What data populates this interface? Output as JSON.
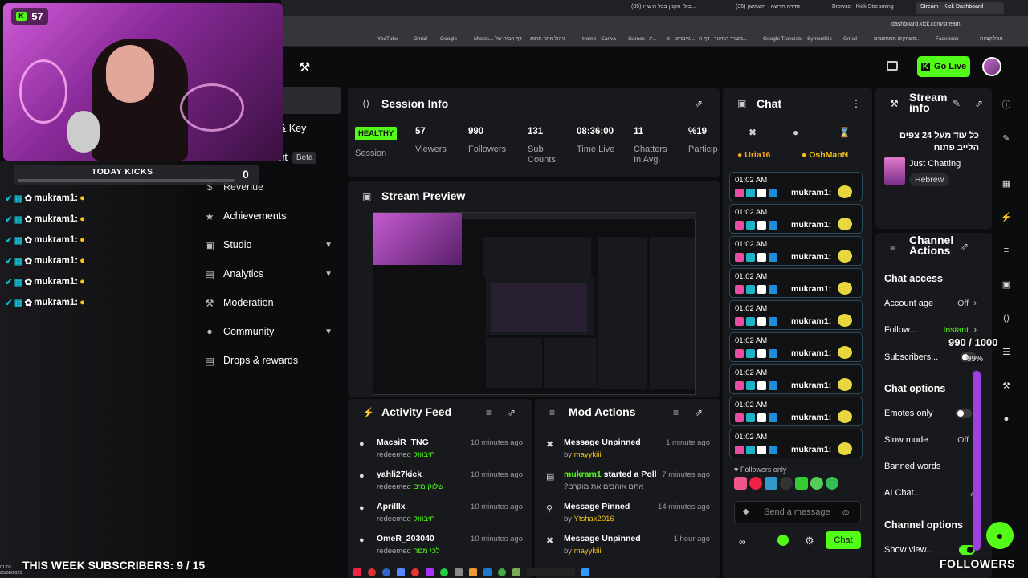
{
  "browser": {
    "tabs": [
      {
        "label": "(35) בולי הקנון בכל איש יו..."
      },
      {
        "label": "(35) סדרה חדשה - השמשון"
      },
      {
        "label": "Browse - Kick Streaming"
      },
      {
        "label": "Stream - Kick Dashboard"
      }
    ],
    "url": "dashboard.kick.com/stream",
    "bookmarks": [
      "YouTube",
      "Gmail",
      "Google",
      "Micros... דף הבית של",
      "ניהול אתר מתוא",
      "Home - Canva",
      "Games | ג'...",
      "גיימרים - פ...",
      "משרד החינוך - דף ה...",
      "Google Translate",
      "SymbolSix",
      "Gmail",
      "משחקים מתחשבים...",
      "Facebook",
      "אפליקציות"
    ]
  },
  "header": {
    "go_live": "Go Live"
  },
  "sidebar": {
    "items": [
      {
        "label": "& Key"
      },
      {
        "label": "Advertisement",
        "badge": "Beta"
      },
      {
        "label": "Revenue"
      },
      {
        "label": "Achievements"
      },
      {
        "label": "Studio"
      },
      {
        "label": "Analytics"
      },
      {
        "label": "Moderation"
      },
      {
        "label": "Community"
      },
      {
        "label": "Drops & rewards"
      }
    ]
  },
  "session": {
    "title": "Session Info",
    "status": "HEALTHY",
    "status_label": "Session",
    "stats": [
      {
        "value": "57",
        "label": "Viewers"
      },
      {
        "value": "990",
        "label": "Followers"
      },
      {
        "value": "131",
        "label": "Sub Counts"
      },
      {
        "value": "08:36:00",
        "label": "Time Live"
      },
      {
        "value": "11",
        "label": "Chatters In Avg."
      },
      {
        "value": "%19",
        "label": "Particip"
      }
    ]
  },
  "preview": {
    "title": "Stream Preview"
  },
  "activity": {
    "title": "Activity Feed",
    "items": [
      {
        "name": "MacsiR_TNG",
        "action": "redeemed",
        "reward": "חיבוווק",
        "time": "10 minutes ago"
      },
      {
        "name": "yahli27kick",
        "action": "redeemed",
        "reward": "שלוק מים",
        "time": "10 minutes ago"
      },
      {
        "name": "Aprilllx",
        "action": "redeemed",
        "reward": "חיבוווק",
        "time": "10 minutes ago"
      },
      {
        "name": "OmeR_203040",
        "action": "redeemed",
        "reward": "לכי מפה",
        "time": "10 minutes ago"
      }
    ]
  },
  "mod": {
    "title": "Mod Actions",
    "items": [
      {
        "title": "Message Unpinned",
        "by": "by",
        "user": "mayykiii",
        "time": "1 minute ago"
      },
      {
        "title": "started a Poll",
        "user_prefix": "mukram1",
        "sub": "?אתם אוהבים את מוקרם",
        "time": "7 minutes ago"
      },
      {
        "title": "Message Pinned",
        "by": "by",
        "user": "Ytshak2016",
        "time": "14 minutes ago"
      },
      {
        "title": "Message Unpinned",
        "by": "by",
        "user": "mayykiii",
        "time": "1 hour ago"
      }
    ]
  },
  "chat": {
    "title": "Chat",
    "pinned_users": [
      "Uria16",
      "OshManN"
    ],
    "messages": [
      {
        "time": "01:02 AM",
        "user": "mukram1:"
      },
      {
        "time": "01:02 AM",
        "user": "mukram1:"
      },
      {
        "time": "01:02 AM",
        "user": "mukram1:"
      },
      {
        "time": "01:02 AM",
        "user": "mukram1:"
      },
      {
        "time": "01:02 AM",
        "user": "mukram1:"
      },
      {
        "time": "01:02 AM",
        "user": "mukram1:"
      },
      {
        "time": "01:02 AM",
        "user": "mukram1:"
      },
      {
        "time": "01:02 AM",
        "user": "mukram1:"
      },
      {
        "time": "01:02 AM",
        "user": "mukram1:"
      }
    ],
    "followers_only": "Followers only",
    "placeholder": "Send a message",
    "send": "Chat"
  },
  "stream_info": {
    "title": "Stream info",
    "stream_title": "כל עוד מעל 24 צפים הלייב פתוח",
    "category": "Just Chatting",
    "tag": "Hebrew"
  },
  "channel_actions": {
    "title": "Channel Actions",
    "chat_access": "Chat access",
    "account_age": "Account age",
    "account_age_val": "Off",
    "follow": "Follow...",
    "follow_val": "Instant",
    "subscribers": "Subscribers...",
    "chat_options": "Chat options",
    "emotes_only": "Emotes only",
    "slow_mode": "Slow mode",
    "slow_mode_val": "Off",
    "banned_words": "Banned words",
    "ai_chat": "AI Chat...",
    "channel_options": "Channel options",
    "show_view": "Show view..."
  },
  "overlay": {
    "viewer_count": "57",
    "today_kicks_label": "TODAY KICKS",
    "today_kicks_value": "0",
    "chat_lines": [
      "mukram1:",
      "mukram1:",
      "mukram1:",
      "mukram1:",
      "mukram1:",
      "mukram1:"
    ],
    "subs_goal": "THIS WEEK SUBSCRIBERS: 9 / 15",
    "followers_goal": "990 / 1000",
    "followers_pct": "99%",
    "followers_pct_value": 0.99,
    "followers_label": "FOLLOWERS",
    "clock": "01:03",
    "date": "25/08/2025"
  },
  "colors": {
    "accent": "#53fc18",
    "panel": "#18191c",
    "bg": "#0b0c0e"
  }
}
